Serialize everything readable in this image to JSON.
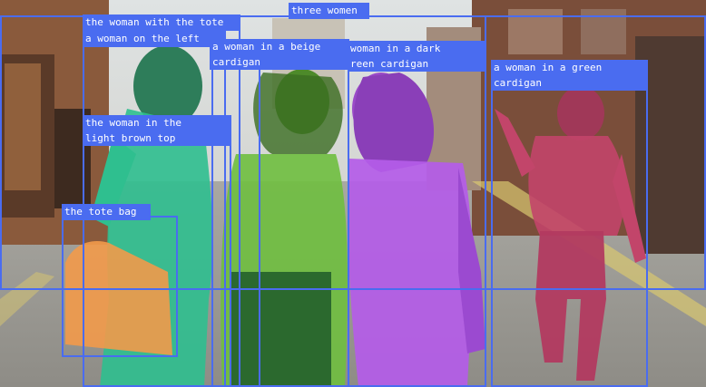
{
  "image": {
    "subject": "street-scene",
    "mask_colors": {
      "woman_left": "#2fbf8f",
      "woman_beige": "#6fbf3f",
      "woman_dark": "#b45ce8",
      "woman_green": "#c2456a",
      "tote_bag": "#f29a4a",
      "box_color": "#4a6cf0"
    }
  },
  "labels": {
    "tote_woman": "the woman with the tote",
    "left_woman": "a woman on the left",
    "three_women": "three women",
    "beige": "a woman in a beige\ncardigan",
    "dark": "woman in a dark\nreen cardigan",
    "green": "a woman in a green\ncardigan",
    "light_brown": "the woman in the\nlight brown top",
    "tote_bag": "the tote bag"
  }
}
